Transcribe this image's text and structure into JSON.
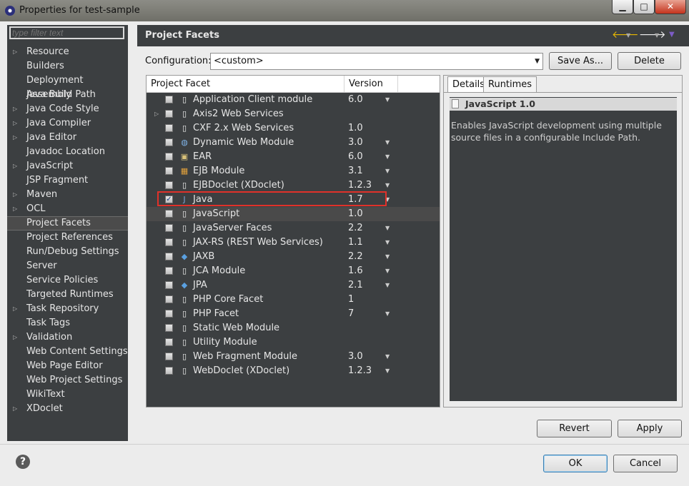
{
  "window": {
    "title": "Properties for test-sample",
    "minimize": "▁",
    "maximize": "□",
    "close": "✕"
  },
  "sidebar": {
    "filter_placeholder": "type filter text",
    "items": [
      {
        "label": "Resource",
        "expandable": true
      },
      {
        "label": "Builders",
        "expandable": false
      },
      {
        "label": "Deployment Assembly",
        "expandable": false
      },
      {
        "label": "Java Build Path",
        "expandable": false
      },
      {
        "label": "Java Code Style",
        "expandable": true
      },
      {
        "label": "Java Compiler",
        "expandable": true
      },
      {
        "label": "Java Editor",
        "expandable": true
      },
      {
        "label": "Javadoc Location",
        "expandable": false
      },
      {
        "label": "JavaScript",
        "expandable": true
      },
      {
        "label": "JSP Fragment",
        "expandable": false
      },
      {
        "label": "Maven",
        "expandable": true
      },
      {
        "label": "OCL",
        "expandable": true
      },
      {
        "label": "Project Facets",
        "expandable": false,
        "selected": true
      },
      {
        "label": "Project References",
        "expandable": false
      },
      {
        "label": "Run/Debug Settings",
        "expandable": false
      },
      {
        "label": "Server",
        "expandable": false
      },
      {
        "label": "Service Policies",
        "expandable": false
      },
      {
        "label": "Targeted Runtimes",
        "expandable": false
      },
      {
        "label": "Task Repository",
        "expandable": true
      },
      {
        "label": "Task Tags",
        "expandable": false
      },
      {
        "label": "Validation",
        "expandable": true
      },
      {
        "label": "Web Content Settings",
        "expandable": false
      },
      {
        "label": "Web Page Editor",
        "expandable": false
      },
      {
        "label": "Web Project Settings",
        "expandable": false
      },
      {
        "label": "WikiText",
        "expandable": false
      },
      {
        "label": "XDoclet",
        "expandable": true
      }
    ]
  },
  "header": {
    "title": "Project Facets",
    "back_icon": "back-arrow-icon",
    "forward_icon": "forward-arrow-icon",
    "menu_icon": "view-menu-icon"
  },
  "config": {
    "label": "Configuration:",
    "value": "<custom>",
    "save_as": "Save As...",
    "delete": "Delete"
  },
  "facets_table": {
    "col_facet": "Project Facet",
    "col_version": "Version",
    "rows": [
      {
        "name": "Application Client module",
        "version": "6.0",
        "checked": false,
        "has_dropdown": true,
        "expandable": false,
        "icon": "page"
      },
      {
        "name": "Axis2 Web Services",
        "version": "",
        "checked": false,
        "has_dropdown": false,
        "expandable": true,
        "icon": "page"
      },
      {
        "name": "CXF 2.x Web Services",
        "version": "1.0",
        "checked": false,
        "has_dropdown": false,
        "expandable": false,
        "icon": "page"
      },
      {
        "name": "Dynamic Web Module",
        "version": "3.0",
        "checked": false,
        "has_dropdown": true,
        "expandable": false,
        "icon": "web"
      },
      {
        "name": "EAR",
        "version": "6.0",
        "checked": false,
        "has_dropdown": true,
        "expandable": false,
        "icon": "ear"
      },
      {
        "name": "EJB Module",
        "version": "3.1",
        "checked": false,
        "has_dropdown": true,
        "expandable": false,
        "icon": "ejb"
      },
      {
        "name": "EJBDoclet (XDoclet)",
        "version": "1.2.3",
        "checked": false,
        "has_dropdown": true,
        "expandable": false,
        "icon": "page"
      },
      {
        "name": "Java",
        "version": "1.7",
        "checked": true,
        "has_dropdown": true,
        "expandable": false,
        "icon": "java"
      },
      {
        "name": "JavaScript",
        "version": "1.0",
        "checked": false,
        "has_dropdown": false,
        "expandable": false,
        "icon": "page",
        "selected": true
      },
      {
        "name": "JavaServer Faces",
        "version": "2.2",
        "checked": false,
        "has_dropdown": true,
        "expandable": false,
        "icon": "page"
      },
      {
        "name": "JAX-RS (REST Web Services)",
        "version": "1.1",
        "checked": false,
        "has_dropdown": true,
        "expandable": false,
        "icon": "page"
      },
      {
        "name": "JAXB",
        "version": "2.2",
        "checked": false,
        "has_dropdown": true,
        "expandable": false,
        "icon": "diamond"
      },
      {
        "name": "JCA Module",
        "version": "1.6",
        "checked": false,
        "has_dropdown": true,
        "expandable": false,
        "icon": "page"
      },
      {
        "name": "JPA",
        "version": "2.1",
        "checked": false,
        "has_dropdown": true,
        "expandable": false,
        "icon": "diamond"
      },
      {
        "name": "PHP Core Facet",
        "version": "1",
        "checked": false,
        "has_dropdown": false,
        "expandable": false,
        "icon": "page"
      },
      {
        "name": "PHP Facet",
        "version": "7",
        "checked": false,
        "has_dropdown": true,
        "expandable": false,
        "icon": "page"
      },
      {
        "name": "Static Web Module",
        "version": "",
        "checked": false,
        "has_dropdown": false,
        "expandable": false,
        "icon": "page"
      },
      {
        "name": "Utility Module",
        "version": "",
        "checked": false,
        "has_dropdown": false,
        "expandable": false,
        "icon": "page"
      },
      {
        "name": "Web Fragment Module",
        "version": "3.0",
        "checked": false,
        "has_dropdown": true,
        "expandable": false,
        "icon": "page"
      },
      {
        "name": "WebDoclet (XDoclet)",
        "version": "1.2.3",
        "checked": false,
        "has_dropdown": true,
        "expandable": false,
        "icon": "page"
      }
    ]
  },
  "details": {
    "tab_details": "Details",
    "tab_runtimes": "Runtimes",
    "title": "JavaScript 1.0",
    "description": "Enables JavaScript development using multiple source files in a configurable Include Path."
  },
  "footer": {
    "revert": "Revert",
    "apply": "Apply",
    "ok": "OK",
    "cancel": "Cancel",
    "help": "?"
  },
  "colors": {
    "highlight_border": "#e0312a",
    "dark_panel": "#3c3f41"
  }
}
